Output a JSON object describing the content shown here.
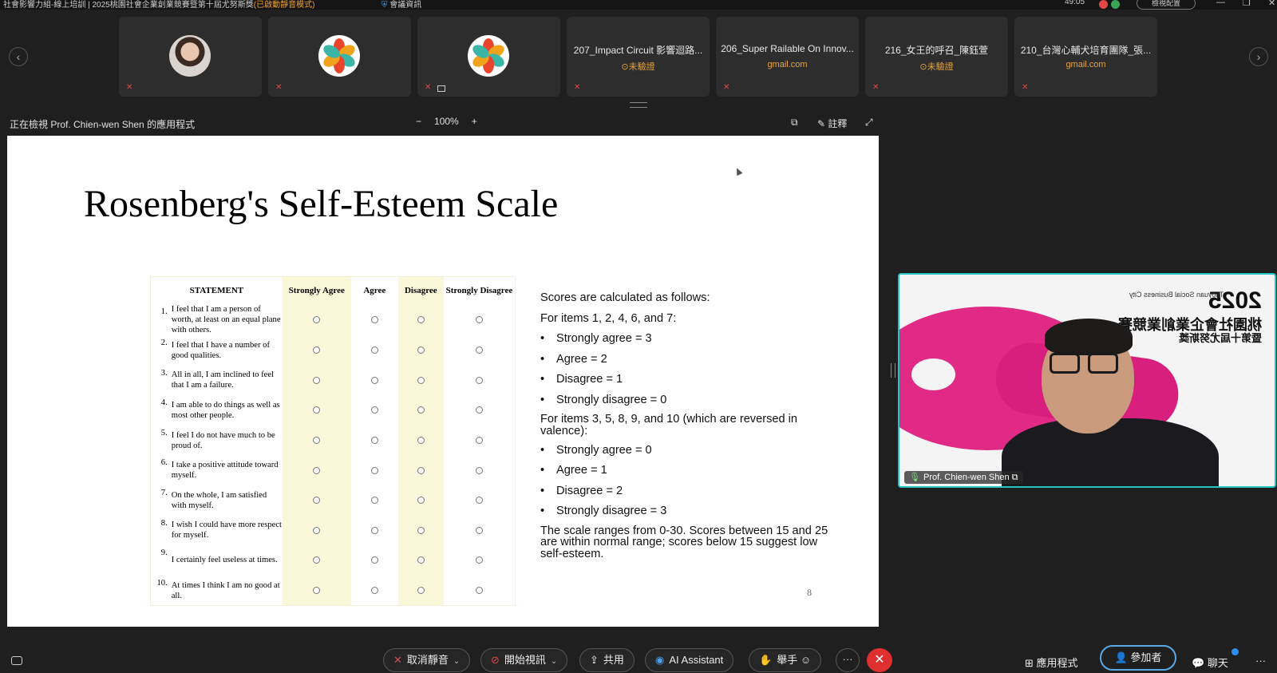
{
  "window": {
    "title": "社會影響力組-線上培訓 | 2025桃園社會企業創業競賽暨第十屆尤努斯獎",
    "title_highlight": "(已啟動靜音模式)",
    "security_label": "會議資訊",
    "timer": "49:05",
    "view_button": "檢視配置"
  },
  "thumbnails": [
    {
      "type": "photo",
      "name": "",
      "sub": ""
    },
    {
      "type": "logo",
      "name": "",
      "sub": ""
    },
    {
      "type": "logo",
      "name": "",
      "sub": ""
    },
    {
      "type": "text",
      "name": "207_Impact Circuit 影響迴路...",
      "sub": "⊙未驗證"
    },
    {
      "type": "text",
      "name": "206_Super Railable On Innov...",
      "sub": "gmail.com"
    },
    {
      "type": "text",
      "name": "216_女王的呼召_陳鈺萱",
      "sub": "⊙未驗證"
    },
    {
      "type": "text",
      "name": "210_台灣心輔犬培育團隊_張...",
      "sub": "gmail.com"
    }
  ],
  "share_bar": {
    "viewing_label": "正在檢視 Prof. Chien-wen Shen 的應用程式",
    "zoom": "100%",
    "annotate_label": "註釋"
  },
  "slide": {
    "title": "Rosenberg's Self-Esteem Scale",
    "page_number": "8",
    "table": {
      "headers": [
        "STATEMENT",
        "Strongly Agree",
        "Agree",
        "Disagree",
        "Strongly Disagree"
      ],
      "rows": [
        {
          "num": "1.",
          "text": "I feel that I am a person of worth, at least on an equal plane with others."
        },
        {
          "num": "2.",
          "text": "I feel that I have a number of good qualities."
        },
        {
          "num": "3.",
          "text": "All in all, I am inclined to feel that I am a failure."
        },
        {
          "num": "4.",
          "text": "I am able to do things as well as most other people."
        },
        {
          "num": "5.",
          "text": "I feel I do not have much to be proud of."
        },
        {
          "num": "6.",
          "text": "I take a positive attitude toward myself."
        },
        {
          "num": "7.",
          "text": "On the whole, I am satisfied with myself."
        },
        {
          "num": "8.",
          "text": "I wish I could have more respect for myself."
        },
        {
          "num": "9.",
          "text": "I certainly feel useless at times."
        },
        {
          "num": "10.",
          "text": "At times I think I am no good at all."
        }
      ]
    },
    "scores": {
      "intro": "Scores are calculated as follows:",
      "group1_label": "For items 1, 2, 4, 6, and 7:",
      "group1": [
        "Strongly agree = 3",
        "Agree = 2",
        "Disagree = 1",
        "Strongly disagree = 0"
      ],
      "group2_label": "For items 3, 5, 8, 9, and 10 (which are reversed in valence):",
      "group2": [
        "Strongly agree = 0",
        "Agree = 1",
        "Disagree = 2",
        "Strongly disagree = 3"
      ],
      "conclusion": "The scale ranges from 0-30. Scores between 15 and 25 are within normal range; scores below 15 suggest low self-esteem."
    }
  },
  "video": {
    "speaker_name": "Prof. Chien-wen Shen",
    "background_text": {
      "year": "2025",
      "sub": "Taoyuan Social Business City",
      "line1": "桃園社會企業創業競賽",
      "line2": "暨第十屆尤努斯獎"
    }
  },
  "toolbar": {
    "unmute": "取消靜音",
    "start_video": "開始視訊",
    "share": "共用",
    "ai_assistant": "AI Assistant",
    "raise_hand": "舉手",
    "more": "···",
    "apps": "應用程式",
    "participants": "參加者",
    "chat": "聊天"
  },
  "colors": {
    "accent_teal": "#23c4c4",
    "leave_red": "#e02f2f",
    "warning_orange": "#e8a23a",
    "table_yellow": "#fbf8d9",
    "participants_blue": "#5aa9e6"
  }
}
